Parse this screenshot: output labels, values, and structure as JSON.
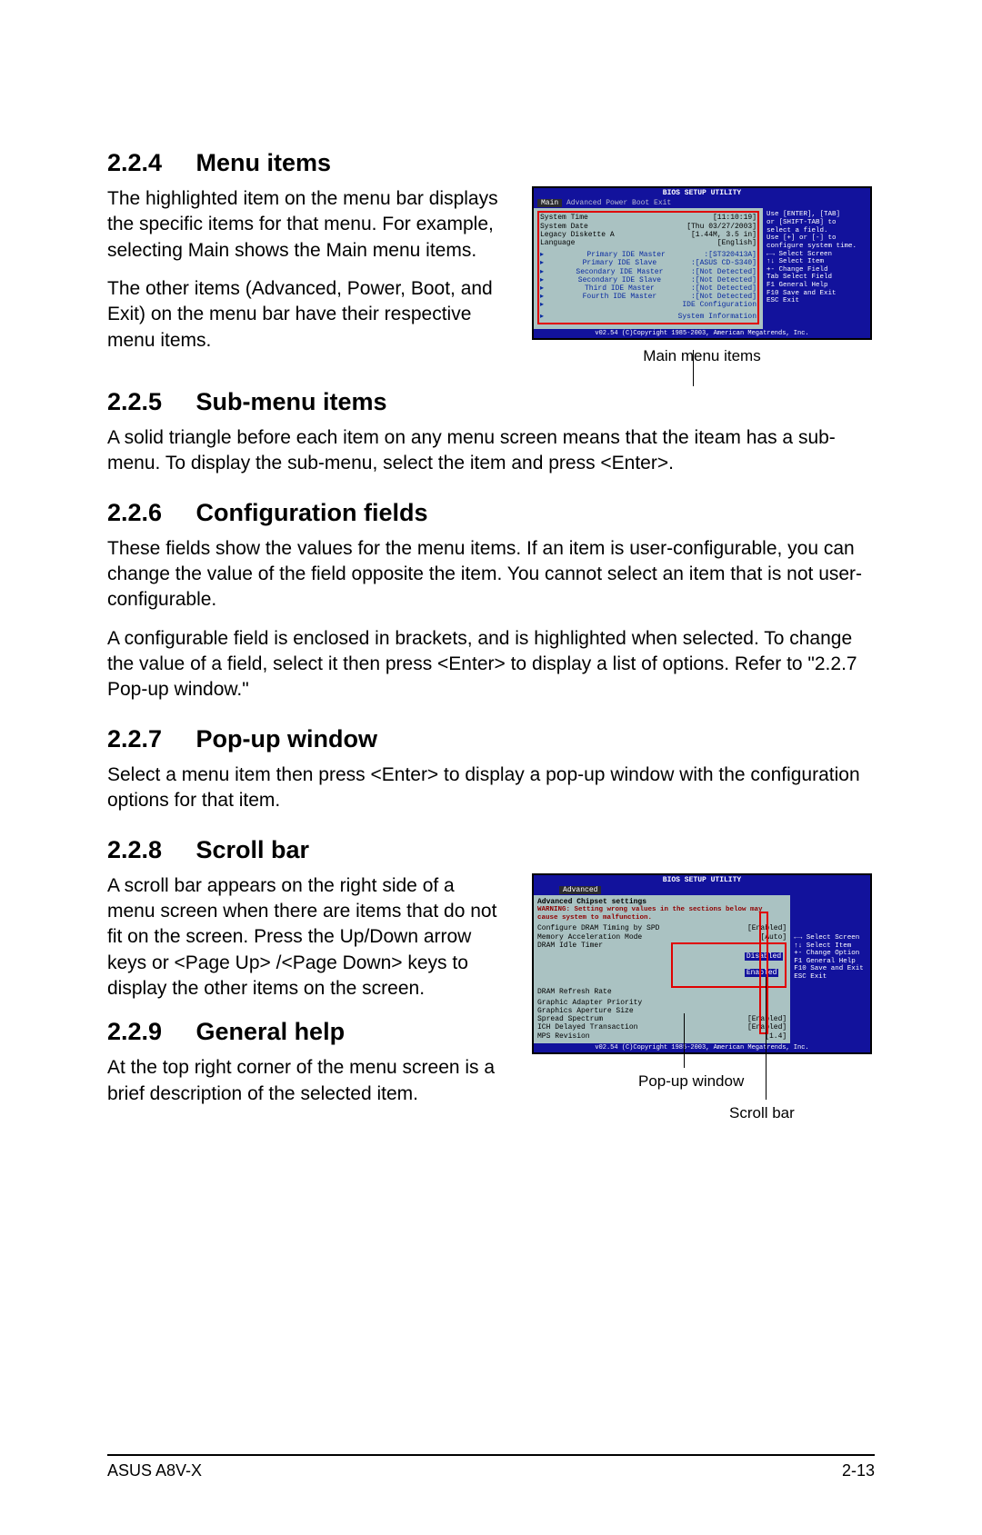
{
  "sections": {
    "s224": {
      "num": "2.2.4",
      "title": "Menu items"
    },
    "s225": {
      "num": "2.2.5",
      "title": "Sub-menu items"
    },
    "s226": {
      "num": "2.2.6",
      "title": "Configuration fields"
    },
    "s227": {
      "num": "2.2.7",
      "title": "Pop-up window"
    },
    "s228": {
      "num": "2.2.8",
      "title": "Scroll bar"
    },
    "s229": {
      "num": "2.2.9",
      "title": "General help"
    }
  },
  "paras": {
    "p224a": "The highlighted item on the menu bar displays the specific items for that menu. For example, selecting Main shows the Main menu items.",
    "p224b": "The other items (Advanced, Power, Boot, and Exit) on the menu bar have their respective menu items.",
    "p225": "A solid triangle before each item on any menu screen means that the iteam has a sub-menu. To display the sub-menu, select the item and press <Enter>.",
    "p226a": "These fields show the values for the menu items. If an item is user-configurable, you can change the value of the field opposite the item. You cannot select an item that is not user-configurable.",
    "p226b": "A configurable field is enclosed in brackets, and is highlighted when selected. To change the value of a field, select it then press <Enter> to display a list of options. Refer to \"2.2.7 Pop-up window.\"",
    "p227": "Select a menu item then press <Enter> to display a pop-up window with the configuration options for that item.",
    "p228": "A scroll bar appears on the right side of a menu screen when there are items that do not fit on the screen. Press the Up/Down arrow keys or <Page Up> /<Page Down> keys to display the other items on the screen.",
    "p229": "At the top right corner of the menu screen is a brief description of the selected item."
  },
  "fig1": {
    "caption": "Main menu items",
    "title": "BIOS SETUP UTILITY",
    "menubar_sel": "Main",
    "menubar_rest": "   Advanced   Power   Boot   Exit",
    "rows": [
      {
        "k": "System Time",
        "v": "[11:10:19]"
      },
      {
        "k": "System Date",
        "v": "[Thu 03/27/2003]"
      },
      {
        "k": "Legacy Diskette A",
        "v": "[1.44M, 3.5 in]"
      },
      {
        "k": "Language",
        "v": "[English]"
      }
    ],
    "subrows": [
      {
        "k": "Primary IDE Master",
        "v": ":[ST320413A]"
      },
      {
        "k": "Primary IDE Slave",
        "v": ":[ASUS CD-S340]"
      },
      {
        "k": "Secondary IDE Master",
        "v": ":[Not Detected]"
      },
      {
        "k": "Secondary IDE Slave",
        "v": ":[Not Detected]"
      },
      {
        "k": "Third IDE Master",
        "v": ":[Not Detected]"
      },
      {
        "k": "Fourth IDE Master",
        "v": ":[Not Detected]"
      },
      {
        "k": "IDE Configuration",
        "v": ""
      }
    ],
    "sysinfo": "System Information",
    "help": [
      "Use [ENTER], [TAB]",
      "or [SHIFT-TAB] to",
      "select a field.",
      "",
      "Use [+] or [-] to",
      "configure system time.",
      "",
      "",
      "←→   Select Screen",
      "↑↓   Select Item",
      "+-   Change Field",
      "Tab  Select Field",
      "F1   General Help",
      "F10  Save and Exit",
      "ESC  Exit"
    ],
    "footer": "v02.54 (C)Copyright 1985-2003, American Megatrends, Inc."
  },
  "fig2": {
    "caption_popup": "Pop-up window",
    "caption_scroll": "Scroll bar",
    "title": "BIOS SETUP UTILITY",
    "menubar": "Advanced",
    "heading": "Advanced Chipset settings",
    "warning": "WARNING: Setting wrong values in the sections below may cause system to malfunction.",
    "rows": [
      {
        "k": "Configure DRAM Timing by SPD",
        "v": "[Enabled]"
      },
      {
        "k": "Memory Acceleration Mode",
        "v": "[Auto]"
      },
      {
        "k": "DRAM Idle Timer",
        "v": ""
      },
      {
        "k": "DRAM Refresh Rate",
        "v": ""
      }
    ],
    "popup_opts": [
      "Disabled",
      "Enabled"
    ],
    "rows2": [
      {
        "k": "Graphic Adapter Priority",
        "v": ""
      },
      {
        "k": "Graphics Aperture Size",
        "v": ""
      },
      {
        "k": "Spread Spectrum",
        "v": "[Enabled]"
      },
      {
        "k": "",
        "v": ""
      },
      {
        "k": "ICH Delayed Transaction",
        "v": "[Enabled]"
      },
      {
        "k": "",
        "v": ""
      },
      {
        "k": "MPS Revision",
        "v": "[1.4]"
      }
    ],
    "help": [
      "←→   Select Screen",
      "↑↓   Select Item",
      "+-   Change Option",
      "F1   General Help",
      "F10  Save and Exit",
      "ESC  Exit"
    ],
    "footer": "v02.54 (C)Copyright 1985-2003, American Megatrends, Inc."
  },
  "footer": {
    "left": "ASUS A8V-X",
    "right": "2-13"
  }
}
